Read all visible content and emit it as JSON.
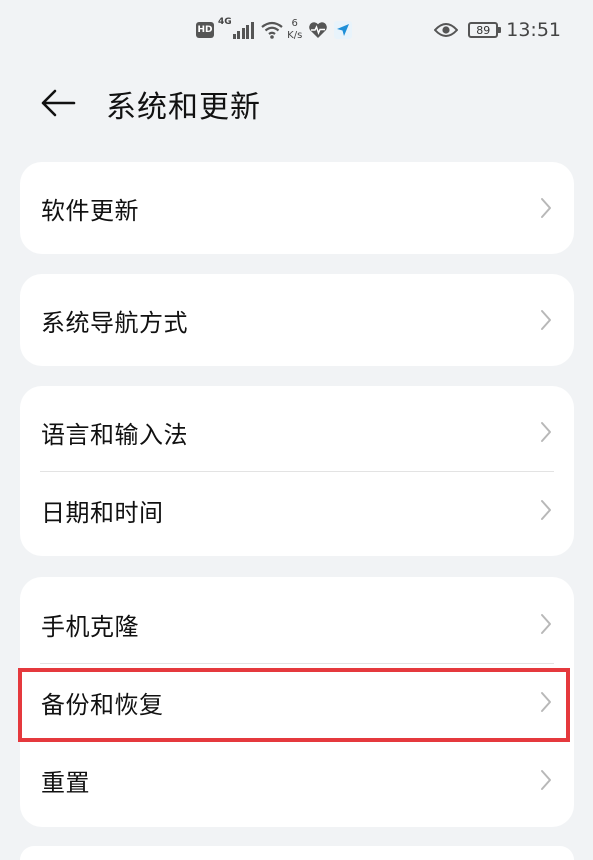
{
  "status_bar": {
    "hd_badge": "HD",
    "network_type": "4G",
    "net_speed_value": "6",
    "net_speed_unit": "K/s",
    "battery_level": "89",
    "time": "13:51"
  },
  "header": {
    "title": "系统和更新"
  },
  "groups": [
    {
      "items": [
        {
          "label": "软件更新"
        }
      ]
    },
    {
      "items": [
        {
          "label": "系统导航方式"
        }
      ]
    },
    {
      "items": [
        {
          "label": "语言和输入法"
        },
        {
          "label": "日期和时间"
        }
      ]
    },
    {
      "items": [
        {
          "label": "手机克隆"
        },
        {
          "label": "备份和恢复"
        },
        {
          "label": "重置"
        }
      ]
    }
  ],
  "colors": {
    "background": "#f1f3f5",
    "card": "#ffffff",
    "highlight_border": "#e5393d",
    "text_primary": "#111111",
    "chevron": "#b8b8b8"
  }
}
